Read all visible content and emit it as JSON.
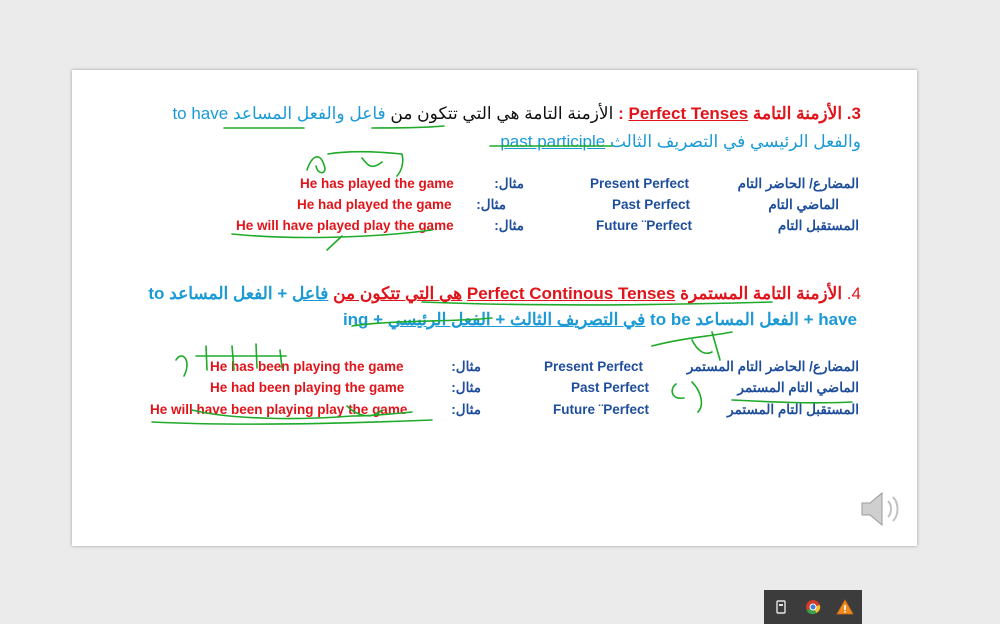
{
  "slide": {
    "s3": {
      "number": "3.",
      "title_ar": "الأزمنة التامة",
      "title_en": "Perfect Tenses",
      "colon": ":",
      "def_ar": "الأزمنة التامة هي التي تتكون من",
      "def_subject": "فاعل",
      "def_aux_ar": "والفعل المساعد",
      "def_aux_en": "to have",
      "line2_ar": "والفعل الرئيسي في التصريف الثالث",
      "line2_en": "past participle",
      "rows": [
        {
          "ar": "المضارع/ الحاضر التام",
          "en": "Present Perfect",
          "label": "مثال:",
          "example": "He has played the game"
        },
        {
          "ar": "الماضي التام",
          "en": "Past Perfect",
          "label": "مثال:",
          "example": "He had  played the game"
        },
        {
          "ar": "المستقبل التام",
          "en": "Future ¨Perfect",
          "label": "مثال:",
          "example": "He will have played play the game"
        }
      ]
    },
    "s4": {
      "number": "4.",
      "title_ar": "الأزمنة التامة المستمرة",
      "title_en": "Perfect Continous Tenses",
      "def_ar": "هي التي تتكون من",
      "def_subject": "فاعل",
      "plus": "+",
      "def_aux_ar": "الفعل المساعد",
      "def_aux_en": "to",
      "line2_en_a": "have",
      "line2_plus": "+",
      "line2_aux_ar": "الفعل المساعد",
      "line2_aux_en": "to be",
      "line2_main_ar": "في التصريف الثالث + الفعل الرئيسي",
      "line2_main_en": "+ ing",
      "rows": [
        {
          "ar": "المضارع/ الحاضر التام المستمر",
          "en": "Present Perfect",
          "label": "مثال:",
          "example": "He has been playing the game"
        },
        {
          "ar": "الماضي التام المستمر",
          "en": "Past Perfect",
          "label": "مثال:",
          "example": "He had been  playing the game"
        },
        {
          "ar": "المستقبل التام المستمر",
          "en": "Future ¨Perfect",
          "label": "مثال:",
          "example": "He will have been playing play the game"
        }
      ]
    }
  },
  "icons": {
    "speaker": "speaker-icon",
    "tray": [
      "usb-device-icon",
      "chrome-icon",
      "warning-icon"
    ]
  },
  "colors": {
    "red": "#e0151b",
    "blue": "#1f4e9c",
    "cyan": "#1b9ad6",
    "ink": "#1faa2a"
  }
}
